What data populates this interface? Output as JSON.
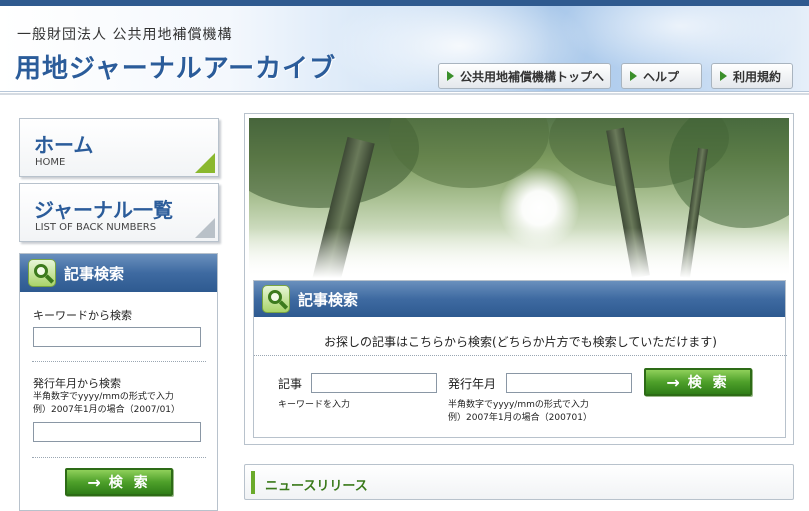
{
  "header": {
    "org_name": "一般財団法人 公共用地補償機構",
    "site_title": "用地ジャーナルアーカイブ",
    "nav": [
      {
        "label": "公共用地補償機構トップへ"
      },
      {
        "label": "ヘルプ"
      },
      {
        "label": "利用規約"
      }
    ]
  },
  "sidebar": {
    "home": {
      "title": "ホーム",
      "subtitle": "HOME"
    },
    "journal_list": {
      "title": "ジャーナル一覧",
      "subtitle": "LIST OF BACK NUMBERS"
    },
    "search": {
      "title": "記事検索",
      "keyword_label": "キーワードから検索",
      "keyword_value": "",
      "date_label": "発行年月から検索",
      "date_note_1": "半角数字でyyyy/mmの形式で入力",
      "date_note_2": "例）2007年1月の場合（2007/01）",
      "date_value": "",
      "button_label": "検 索"
    }
  },
  "main": {
    "search": {
      "title": "記事検索",
      "instruction": "お探しの記事はこちらから検索(どちらか片方でも検索していただけます)",
      "article_label": "記事",
      "article_value": "",
      "article_note": "キーワードを入力",
      "date_label": "発行年月",
      "date_value": "",
      "date_note_1": "半角数字でyyyy/mmの形式で入力",
      "date_note_2": "例）2007年1月の場合（200701）",
      "button_label": "検 索"
    },
    "news": {
      "title": "ニュースリリース"
    }
  },
  "icons": {
    "nav_arrow": "triangle-right-icon",
    "search": "magnifier-icon",
    "button_arrow": "arrow-right-icon"
  },
  "colors": {
    "brand_blue": "#2b5c9a",
    "panel_blue": "#3e6aa1",
    "accent_green": "#4ea02a"
  }
}
